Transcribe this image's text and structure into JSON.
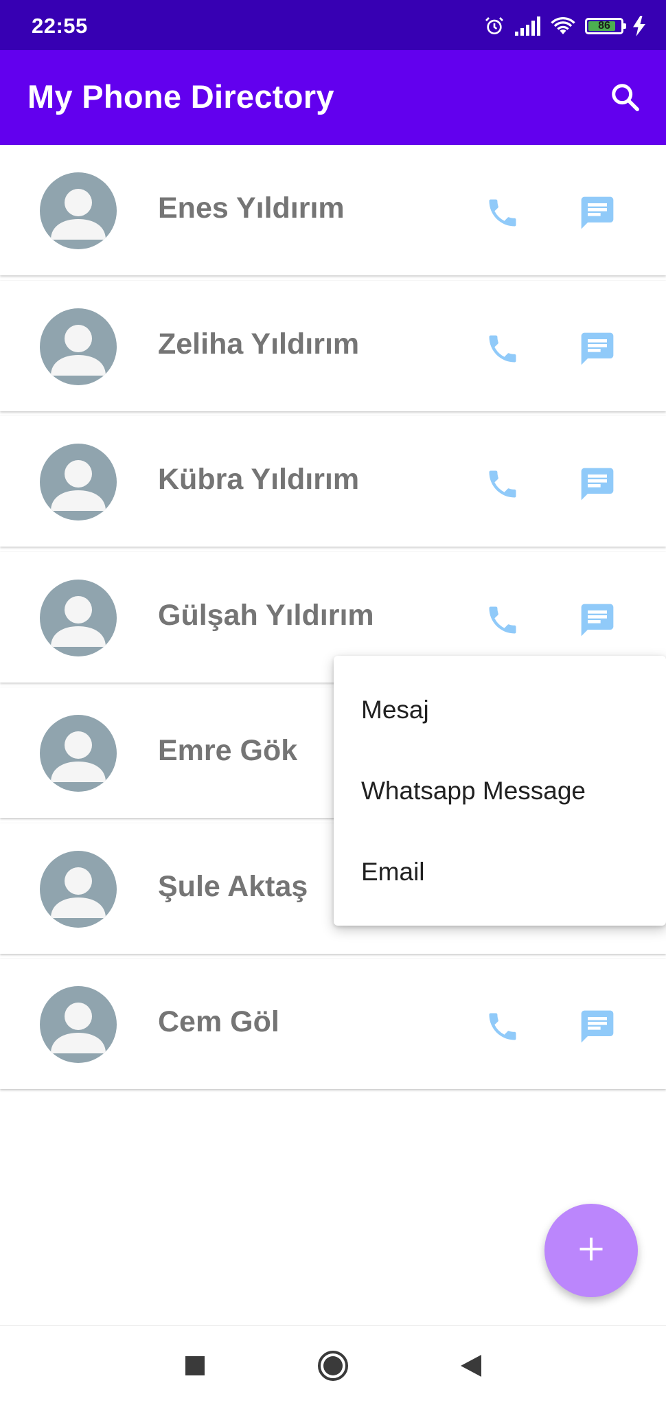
{
  "status_bar": {
    "time": "22:55",
    "battery_level": "86",
    "battery_fraction": 0.86,
    "icons": [
      "alarm-icon",
      "signal-icon",
      "wifi-icon",
      "battery-icon",
      "charging-icon"
    ]
  },
  "app_bar": {
    "title": "My Phone Directory",
    "search_icon": "search-icon",
    "color": "#6200ee"
  },
  "contacts": [
    {
      "name": "Enes Yıldırım"
    },
    {
      "name": "Zeliha Yıldırım"
    },
    {
      "name": "Kübra Yıldırım"
    },
    {
      "name": "Gülşah Yıldırım"
    },
    {
      "name": "Emre Gök"
    },
    {
      "name": "Şule Aktaş"
    },
    {
      "name": "Cem Göl"
    }
  ],
  "popup_menu": {
    "items": [
      "Mesaj",
      "Whatsapp Message",
      "Email"
    ]
  },
  "fab": {
    "icon": "plus-icon",
    "color": "#bb86fc"
  },
  "nav_bar": {
    "icons": [
      "recents-icon",
      "home-icon",
      "back-icon"
    ]
  },
  "colors": {
    "status_bar": "#3700b3",
    "avatar": "#90a4ae",
    "action_icon": "#90caf9",
    "name_text": "#757575"
  }
}
